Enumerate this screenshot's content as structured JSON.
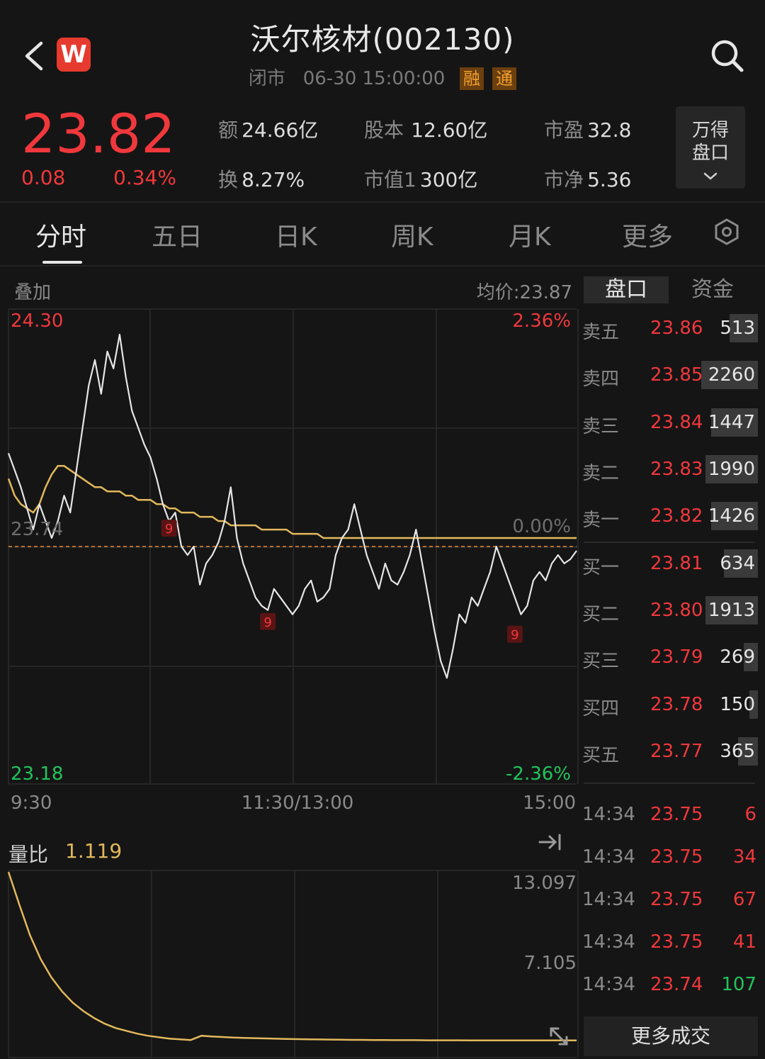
{
  "header": {
    "title": "沃尔核材(002130)",
    "status": "闭市",
    "datetime": "06-30 15:00:00",
    "tags": [
      "融",
      "通"
    ],
    "logo_letter": "W",
    "icons": {
      "back": "chevron-left-icon",
      "search": "search-icon",
      "settings": "hexagon-settings-icon"
    }
  },
  "quote": {
    "price": "23.82",
    "change": "0.08",
    "change_pct": "0.34%",
    "amount_label": "额",
    "amount": "24.66亿",
    "turnover_label": "换",
    "turnover": "8.27%",
    "shares_label": "股本",
    "shares": "12.60亿",
    "mktcap_label": "市值1",
    "mktcap": "300亿",
    "pe_label": "市盈",
    "pe": "32.8",
    "pb_label": "市净",
    "pb": "5.36",
    "wande_line1": "万得",
    "wande_line2": "盘口"
  },
  "tabs": [
    "分时",
    "五日",
    "日K",
    "周K",
    "月K",
    "更多"
  ],
  "chart": {
    "overlay_label": "叠加",
    "avg_price_text": "均价:23.87",
    "y_top": "24.30",
    "y_mid": "23.74",
    "y_bot": "23.18",
    "pct_top": "2.36%",
    "pct_mid": "0.00%",
    "pct_bot": "-2.36%",
    "x_labels": [
      "9:30",
      "11:30/13:00",
      "15:00"
    ],
    "vol_ratio_label": "量比",
    "vol_ratio_value": "1.119",
    "vol_axis_top": "13.097",
    "vol_axis_mid": "7.105",
    "colors": {
      "price": "#e6e6e6",
      "avg": "#e2b85c",
      "ref": "#e58a2e",
      "up": "#f0383c",
      "down": "#23c35c"
    }
  },
  "chart_data": {
    "type": "line",
    "title": "",
    "ylim": [
      23.18,
      24.3
    ],
    "reference_price": 23.74,
    "series": [
      {
        "values": [
          23.96,
          23.92,
          23.88,
          23.83,
          23.78,
          23.84,
          23.8,
          23.76,
          23.8,
          23.86,
          23.82,
          23.92,
          24.02,
          24.12,
          24.18,
          24.1,
          24.2,
          24.16,
          24.24,
          24.14,
          24.06,
          24.02,
          23.98,
          23.95,
          23.9,
          23.84,
          23.8,
          23.82,
          23.74,
          23.72,
          23.74,
          23.65,
          23.7,
          23.72,
          23.75,
          23.8,
          23.88,
          23.76,
          23.7,
          23.66,
          23.62,
          23.6,
          23.59,
          23.64,
          23.62,
          23.6,
          23.58,
          23.6,
          23.64,
          23.66,
          23.61,
          23.62,
          23.64,
          23.72,
          23.76,
          23.78,
          23.84,
          23.78,
          23.72,
          23.68,
          23.64,
          23.7,
          23.66,
          23.65,
          23.68,
          23.72,
          23.78,
          23.7,
          23.62,
          23.54,
          23.47,
          23.43,
          23.5,
          23.58,
          23.56,
          23.62,
          23.6,
          23.64,
          23.68,
          23.74,
          23.7,
          23.66,
          23.62,
          23.58,
          23.6,
          23.66,
          23.68,
          23.66,
          23.7,
          23.72,
          23.7,
          23.71,
          23.73
        ]
      },
      {
        "values": [
          23.9,
          23.86,
          23.84,
          23.83,
          23.82,
          23.84,
          23.88,
          23.91,
          23.93,
          23.93,
          23.92,
          23.91,
          23.9,
          23.89,
          23.88,
          23.88,
          23.87,
          23.87,
          23.87,
          23.86,
          23.86,
          23.85,
          23.85,
          23.85,
          23.84,
          23.84,
          23.83,
          23.83,
          23.82,
          23.82,
          23.82,
          23.81,
          23.81,
          23.81,
          23.8,
          23.8,
          23.79,
          23.79,
          23.79,
          23.79,
          23.79,
          23.78,
          23.78,
          23.78,
          23.78,
          23.78,
          23.77,
          23.77,
          23.77,
          23.77,
          23.77,
          23.76,
          23.76,
          23.76,
          23.76,
          23.76,
          23.76,
          23.76,
          23.76,
          23.76,
          23.76,
          23.76,
          23.76,
          23.76,
          23.76,
          23.76,
          23.76,
          23.76,
          23.76,
          23.76,
          23.76,
          23.76,
          23.76,
          23.76,
          23.76,
          23.76,
          23.76,
          23.76,
          23.76,
          23.76,
          23.76,
          23.76,
          23.76,
          23.76,
          23.76,
          23.76,
          23.76,
          23.76,
          23.76,
          23.76,
          23.76,
          23.76,
          23.76
        ]
      }
    ],
    "markers": [
      {
        "x_index": 26,
        "price": 23.82
      },
      {
        "x_index": 42,
        "price": 23.6
      },
      {
        "x_index": 82,
        "price": 23.57
      }
    ],
    "volume_ratio": {
      "ylim": [
        0,
        13.097
      ],
      "values": [
        13.09,
        10.8,
        8.6,
        6.9,
        5.6,
        4.6,
        3.8,
        3.2,
        2.7,
        2.3,
        2.0,
        1.8,
        1.6,
        1.45,
        1.35,
        1.25,
        1.2,
        1.15,
        1.45,
        1.4,
        1.36,
        1.32,
        1.3,
        1.28,
        1.26,
        1.24,
        1.22,
        1.21,
        1.2,
        1.19,
        1.18,
        1.17,
        1.16,
        1.16,
        1.15,
        1.15,
        1.14,
        1.14,
        1.14,
        1.13,
        1.13,
        1.13,
        1.13,
        1.12,
        1.12,
        1.12,
        1.12,
        1.12,
        1.12,
        1.12,
        1.12,
        1.12,
        1.12,
        1.119
      ]
    }
  },
  "order_book": {
    "tab_active": "盘口",
    "tab_other": "资金",
    "asks": [
      {
        "label": "卖五",
        "price": "23.86",
        "vol": "513"
      },
      {
        "label": "卖四",
        "price": "23.85",
        "vol": "2260"
      },
      {
        "label": "卖三",
        "price": "23.84",
        "vol": "1447"
      },
      {
        "label": "卖二",
        "price": "23.83",
        "vol": "1990"
      },
      {
        "label": "卖一",
        "price": "23.82",
        "vol": "1426"
      }
    ],
    "bids": [
      {
        "label": "买一",
        "price": "23.81",
        "vol": "634"
      },
      {
        "label": "买二",
        "price": "23.80",
        "vol": "1913"
      },
      {
        "label": "买三",
        "price": "23.79",
        "vol": "269"
      },
      {
        "label": "买四",
        "price": "23.78",
        "vol": "150"
      },
      {
        "label": "买五",
        "price": "23.77",
        "vol": "365"
      }
    ],
    "ticks": [
      {
        "time": "14:34",
        "price": "23.75",
        "vol": "6",
        "dir": "sell"
      },
      {
        "time": "14:34",
        "price": "23.75",
        "vol": "34",
        "dir": "sell"
      },
      {
        "time": "14:34",
        "price": "23.75",
        "vol": "67",
        "dir": "sell"
      },
      {
        "time": "14:34",
        "price": "23.75",
        "vol": "41",
        "dir": "sell"
      },
      {
        "time": "14:34",
        "price": "23.74",
        "vol": "107",
        "dir": "buy"
      }
    ],
    "more_trades": "更多成交"
  }
}
